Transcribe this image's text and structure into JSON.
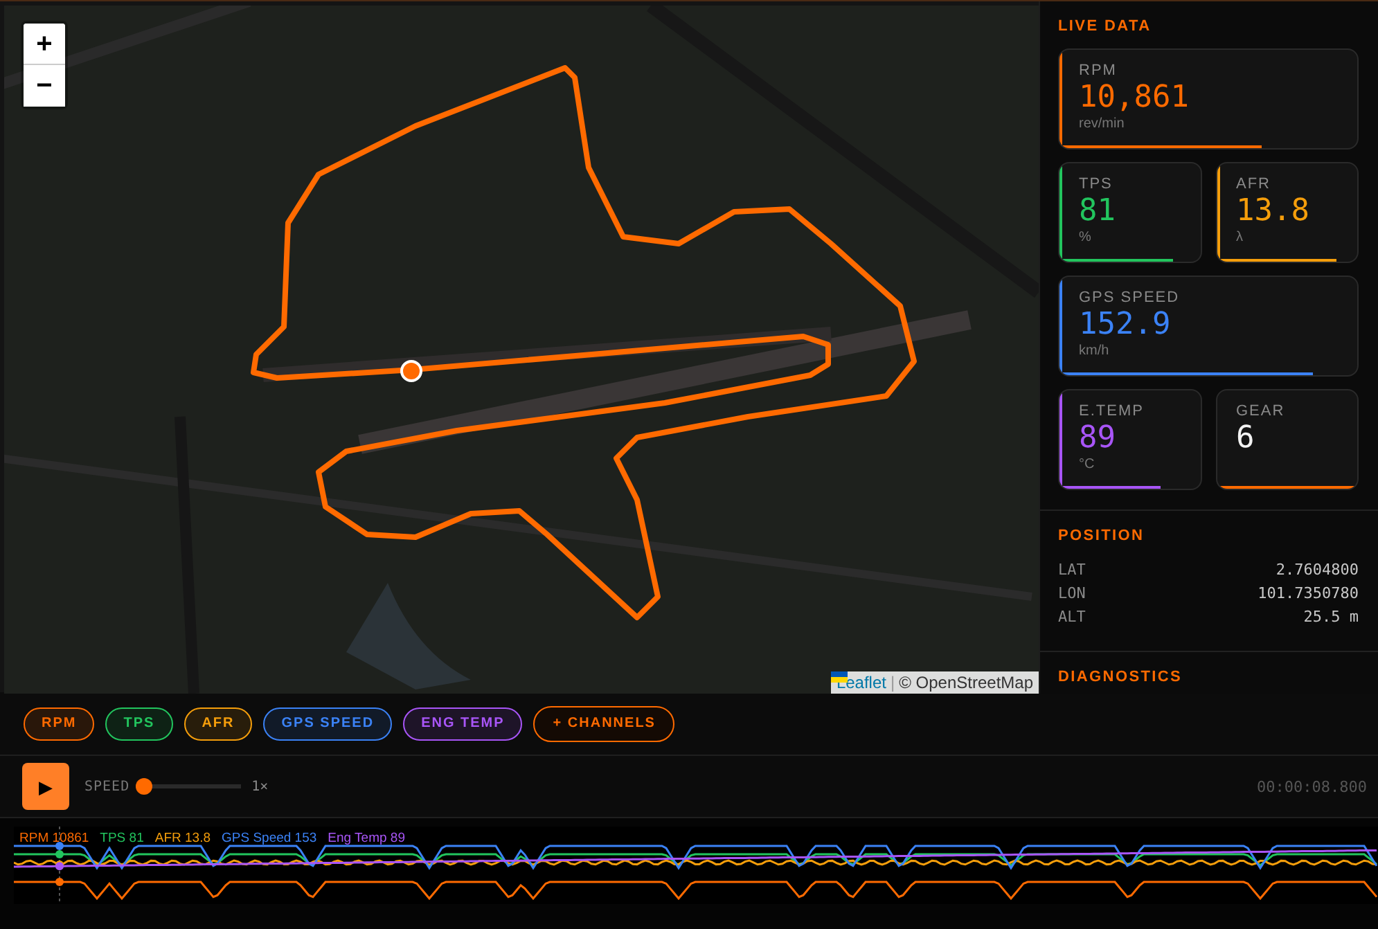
{
  "map": {
    "zoom_in": "+",
    "zoom_out": "−",
    "attribution": {
      "link": "Leaflet",
      "separator": "|",
      "text": "© OpenStreetMap"
    }
  },
  "live_data": {
    "title": "LIVE DATA",
    "cards": [
      {
        "kind": "gauge",
        "label": "RPM",
        "value": "10,861",
        "unit": "rev/min",
        "color": "#ff6a00",
        "level": 0.68,
        "wide": true
      },
      {
        "kind": "gauge",
        "label": "TPS",
        "value": "81",
        "unit": "%",
        "color": "#22c55e",
        "level": 0.81,
        "wide": false
      },
      {
        "kind": "gauge",
        "label": "AFR",
        "value": "13.8",
        "unit": "λ",
        "color": "#f59e0b",
        "level": 0.85,
        "wide": false
      },
      {
        "kind": "gauge",
        "label": "GPS SPEED",
        "value": "152.9",
        "unit": "km/h",
        "color": "#3b82f6",
        "level": 0.85,
        "wide": true
      },
      {
        "kind": "gauge",
        "label": "E.TEMP",
        "value": "89",
        "unit": "°C",
        "color": "#a855f7",
        "level": 0.72,
        "wide": false
      },
      {
        "kind": "plain",
        "label": "GEAR",
        "value": "6",
        "color": "#ff6a00",
        "level": 1,
        "wide": false
      }
    ]
  },
  "position": {
    "title": "POSITION",
    "rows": [
      {
        "label": "LAT",
        "value": "2.7604800"
      },
      {
        "label": "LON",
        "value": "101.7350780"
      },
      {
        "label": "ALT",
        "value": "25.5 m"
      }
    ]
  },
  "diagnostics": {
    "title": "DIAGNOSTICS"
  },
  "channels": [
    {
      "kind": "channel",
      "label": "RPM",
      "color": "#ff6a00"
    },
    {
      "kind": "channel",
      "label": "TPS",
      "color": "#22c55e"
    },
    {
      "kind": "channel",
      "label": "AFR",
      "color": "#f59e0b"
    },
    {
      "kind": "channel",
      "label": "GPS SPEED",
      "color": "#3b82f6"
    },
    {
      "kind": "channel",
      "label": "ENG TEMP",
      "color": "#a855f7"
    },
    {
      "kind": "add",
      "label": "+ CHANNELS",
      "color": "#ff6a00"
    }
  ],
  "playback": {
    "play": "▶",
    "speed_label": "SPEED",
    "speed": {
      "level": 0
    },
    "speed_value": "1×",
    "time": "00:00:08.800"
  },
  "trace": {
    "legend": [
      {
        "text": "RPM 10861",
        "color": "#ff6a00"
      },
      {
        "text": "TPS 81",
        "color": "#22c55e"
      },
      {
        "text": "AFR 13.8",
        "color": "#f59e0b"
      },
      {
        "text": "GPS Speed 153",
        "color": "#3b82f6"
      },
      {
        "text": "Eng Temp 89",
        "color": "#a855f7"
      }
    ]
  }
}
